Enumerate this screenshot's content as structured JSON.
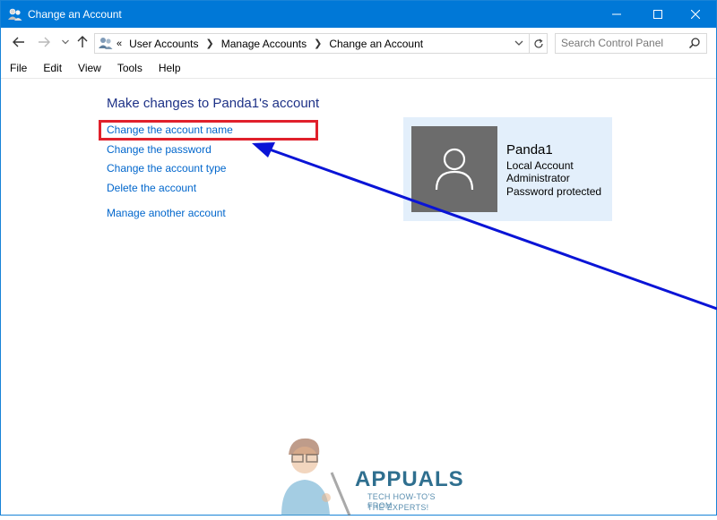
{
  "window": {
    "title": "Change an Account",
    "controls": {
      "minimize_icon": "minimize-icon",
      "maximize_icon": "maximize-icon",
      "close_icon": "close-icon"
    }
  },
  "address_bar": {
    "overflow_label": "«",
    "crumbs": [
      "User Accounts",
      "Manage Accounts",
      "Change an Account"
    ],
    "search_placeholder": "Search Control Panel"
  },
  "menu": [
    "File",
    "Edit",
    "View",
    "Tools",
    "Help"
  ],
  "main": {
    "heading": "Make changes to Panda1's account",
    "links": [
      "Change the account name",
      "Change the password",
      "Change the account type",
      "Delete the account",
      "Manage another account"
    ]
  },
  "account": {
    "name": "Panda1",
    "type": "Local Account",
    "role": "Administrator",
    "security": "Password protected"
  },
  "watermark": {
    "brand": "APPUALS",
    "tagline_1": "TECH HOW-TO'S FROM",
    "tagline_2": "THE EXPERTS!"
  },
  "colors": {
    "accent": "#0078d7",
    "link": "#0066cc",
    "heading": "#1e3287",
    "highlight": "#e0202b",
    "arrow": "#0a14d6"
  }
}
